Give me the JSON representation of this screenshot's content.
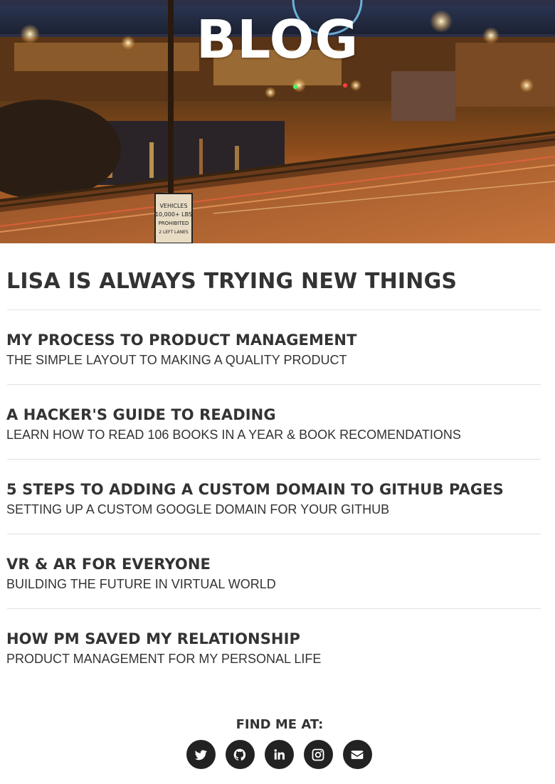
{
  "hero": {
    "title": "BLOG"
  },
  "tagline": "LISA IS ALWAYS TRYING NEW THINGS",
  "posts": [
    {
      "title": "MY PROCESS TO PRODUCT MANAGEMENT",
      "subtitle": "THE SIMPLE LAYOUT TO MAKING A QUALITY PRODUCT"
    },
    {
      "title": "A HACKER'S GUIDE TO READING",
      "subtitle": "LEARN HOW TO READ 106 BOOKS IN A YEAR & BOOK RECOMENDATIONS"
    },
    {
      "title": "5 STEPS TO ADDING A CUSTOM DOMAIN TO GITHUB PAGES",
      "subtitle": "SETTING UP A CUSTOM GOOGLE DOMAIN FOR YOUR GITHUB"
    },
    {
      "title": "VR & AR FOR EVERYONE",
      "subtitle": "BUILDING THE FUTURE IN VIRTUAL WORLD"
    },
    {
      "title": "HOW PM SAVED MY RELATIONSHIP",
      "subtitle": "PRODUCT MANAGEMENT FOR MY PERSONAL LIFE"
    }
  ],
  "hero_sign": [
    "VEHICLES",
    "10,000+ LBS",
    "PROHIBITED",
    "2 LEFT LANES"
  ],
  "footer": {
    "label": "FIND ME AT:",
    "social": [
      "twitter-icon",
      "github-icon",
      "linkedin-icon",
      "instagram-icon",
      "envelope-icon"
    ]
  },
  "colors": {
    "text": "#333333",
    "icon_bg": "#222222",
    "divider": "#e2e2e2"
  }
}
